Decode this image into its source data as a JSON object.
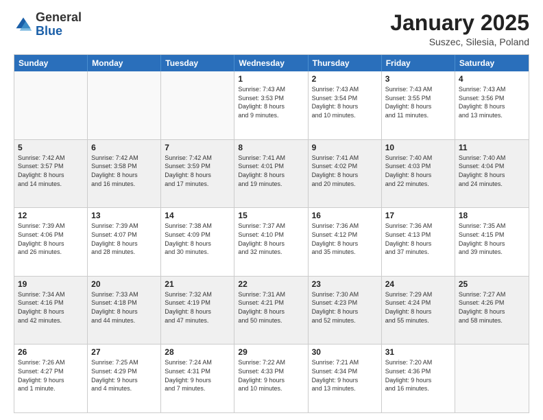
{
  "header": {
    "logo_general": "General",
    "logo_blue": "Blue",
    "month_title": "January 2025",
    "location": "Suszec, Silesia, Poland"
  },
  "weekdays": [
    "Sunday",
    "Monday",
    "Tuesday",
    "Wednesday",
    "Thursday",
    "Friday",
    "Saturday"
  ],
  "rows": [
    [
      {
        "day": "",
        "lines": [],
        "empty": true
      },
      {
        "day": "",
        "lines": [],
        "empty": true
      },
      {
        "day": "",
        "lines": [],
        "empty": true
      },
      {
        "day": "1",
        "lines": [
          "Sunrise: 7:43 AM",
          "Sunset: 3:53 PM",
          "Daylight: 8 hours",
          "and 9 minutes."
        ]
      },
      {
        "day": "2",
        "lines": [
          "Sunrise: 7:43 AM",
          "Sunset: 3:54 PM",
          "Daylight: 8 hours",
          "and 10 minutes."
        ]
      },
      {
        "day": "3",
        "lines": [
          "Sunrise: 7:43 AM",
          "Sunset: 3:55 PM",
          "Daylight: 8 hours",
          "and 11 minutes."
        ]
      },
      {
        "day": "4",
        "lines": [
          "Sunrise: 7:43 AM",
          "Sunset: 3:56 PM",
          "Daylight: 8 hours",
          "and 13 minutes."
        ]
      }
    ],
    [
      {
        "day": "5",
        "lines": [
          "Sunrise: 7:42 AM",
          "Sunset: 3:57 PM",
          "Daylight: 8 hours",
          "and 14 minutes."
        ],
        "shaded": true
      },
      {
        "day": "6",
        "lines": [
          "Sunrise: 7:42 AM",
          "Sunset: 3:58 PM",
          "Daylight: 8 hours",
          "and 16 minutes."
        ],
        "shaded": true
      },
      {
        "day": "7",
        "lines": [
          "Sunrise: 7:42 AM",
          "Sunset: 3:59 PM",
          "Daylight: 8 hours",
          "and 17 minutes."
        ],
        "shaded": true
      },
      {
        "day": "8",
        "lines": [
          "Sunrise: 7:41 AM",
          "Sunset: 4:01 PM",
          "Daylight: 8 hours",
          "and 19 minutes."
        ],
        "shaded": true
      },
      {
        "day": "9",
        "lines": [
          "Sunrise: 7:41 AM",
          "Sunset: 4:02 PM",
          "Daylight: 8 hours",
          "and 20 minutes."
        ],
        "shaded": true
      },
      {
        "day": "10",
        "lines": [
          "Sunrise: 7:40 AM",
          "Sunset: 4:03 PM",
          "Daylight: 8 hours",
          "and 22 minutes."
        ],
        "shaded": true
      },
      {
        "day": "11",
        "lines": [
          "Sunrise: 7:40 AM",
          "Sunset: 4:04 PM",
          "Daylight: 8 hours",
          "and 24 minutes."
        ],
        "shaded": true
      }
    ],
    [
      {
        "day": "12",
        "lines": [
          "Sunrise: 7:39 AM",
          "Sunset: 4:06 PM",
          "Daylight: 8 hours",
          "and 26 minutes."
        ]
      },
      {
        "day": "13",
        "lines": [
          "Sunrise: 7:39 AM",
          "Sunset: 4:07 PM",
          "Daylight: 8 hours",
          "and 28 minutes."
        ]
      },
      {
        "day": "14",
        "lines": [
          "Sunrise: 7:38 AM",
          "Sunset: 4:09 PM",
          "Daylight: 8 hours",
          "and 30 minutes."
        ]
      },
      {
        "day": "15",
        "lines": [
          "Sunrise: 7:37 AM",
          "Sunset: 4:10 PM",
          "Daylight: 8 hours",
          "and 32 minutes."
        ]
      },
      {
        "day": "16",
        "lines": [
          "Sunrise: 7:36 AM",
          "Sunset: 4:12 PM",
          "Daylight: 8 hours",
          "and 35 minutes."
        ]
      },
      {
        "day": "17",
        "lines": [
          "Sunrise: 7:36 AM",
          "Sunset: 4:13 PM",
          "Daylight: 8 hours",
          "and 37 minutes."
        ]
      },
      {
        "day": "18",
        "lines": [
          "Sunrise: 7:35 AM",
          "Sunset: 4:15 PM",
          "Daylight: 8 hours",
          "and 39 minutes."
        ]
      }
    ],
    [
      {
        "day": "19",
        "lines": [
          "Sunrise: 7:34 AM",
          "Sunset: 4:16 PM",
          "Daylight: 8 hours",
          "and 42 minutes."
        ],
        "shaded": true
      },
      {
        "day": "20",
        "lines": [
          "Sunrise: 7:33 AM",
          "Sunset: 4:18 PM",
          "Daylight: 8 hours",
          "and 44 minutes."
        ],
        "shaded": true
      },
      {
        "day": "21",
        "lines": [
          "Sunrise: 7:32 AM",
          "Sunset: 4:19 PM",
          "Daylight: 8 hours",
          "and 47 minutes."
        ],
        "shaded": true
      },
      {
        "day": "22",
        "lines": [
          "Sunrise: 7:31 AM",
          "Sunset: 4:21 PM",
          "Daylight: 8 hours",
          "and 50 minutes."
        ],
        "shaded": true
      },
      {
        "day": "23",
        "lines": [
          "Sunrise: 7:30 AM",
          "Sunset: 4:23 PM",
          "Daylight: 8 hours",
          "and 52 minutes."
        ],
        "shaded": true
      },
      {
        "day": "24",
        "lines": [
          "Sunrise: 7:29 AM",
          "Sunset: 4:24 PM",
          "Daylight: 8 hours",
          "and 55 minutes."
        ],
        "shaded": true
      },
      {
        "day": "25",
        "lines": [
          "Sunrise: 7:27 AM",
          "Sunset: 4:26 PM",
          "Daylight: 8 hours",
          "and 58 minutes."
        ],
        "shaded": true
      }
    ],
    [
      {
        "day": "26",
        "lines": [
          "Sunrise: 7:26 AM",
          "Sunset: 4:27 PM",
          "Daylight: 9 hours",
          "and 1 minute."
        ]
      },
      {
        "day": "27",
        "lines": [
          "Sunrise: 7:25 AM",
          "Sunset: 4:29 PM",
          "Daylight: 9 hours",
          "and 4 minutes."
        ]
      },
      {
        "day": "28",
        "lines": [
          "Sunrise: 7:24 AM",
          "Sunset: 4:31 PM",
          "Daylight: 9 hours",
          "and 7 minutes."
        ]
      },
      {
        "day": "29",
        "lines": [
          "Sunrise: 7:22 AM",
          "Sunset: 4:33 PM",
          "Daylight: 9 hours",
          "and 10 minutes."
        ]
      },
      {
        "day": "30",
        "lines": [
          "Sunrise: 7:21 AM",
          "Sunset: 4:34 PM",
          "Daylight: 9 hours",
          "and 13 minutes."
        ]
      },
      {
        "day": "31",
        "lines": [
          "Sunrise: 7:20 AM",
          "Sunset: 4:36 PM",
          "Daylight: 9 hours",
          "and 16 minutes."
        ]
      },
      {
        "day": "",
        "lines": [],
        "empty": true
      }
    ]
  ]
}
